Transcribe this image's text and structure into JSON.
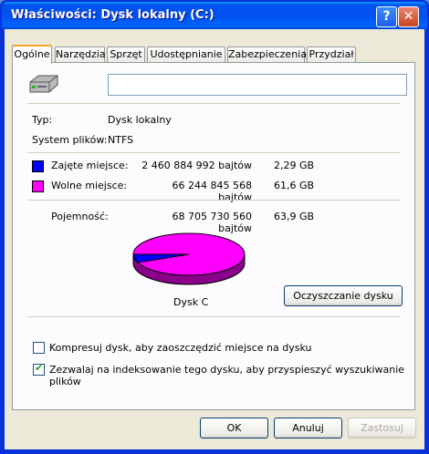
{
  "window": {
    "title": "Właściwości: Dysk lokalny (C:)",
    "help_glyph": "?",
    "close_glyph": "✕"
  },
  "tabs": [
    "Ogólne",
    "Narzędzia",
    "Sprzęt",
    "Udostępnianie",
    "Zabezpieczenia",
    "Przydział"
  ],
  "general": {
    "name_value": "",
    "type_label": "Typ:",
    "type_value": "Dysk lokalny",
    "fs_label": "System plików:",
    "fs_value": "NTFS",
    "used_label": "Zajęte miejsce:",
    "used_bytes": "2 460 884 992 bajtów",
    "used_gb": "2,29 GB",
    "free_label": "Wolne miejsce:",
    "free_bytes": "66 244 845 568 bajtów",
    "free_gb": "61,6 GB",
    "capacity_label": "Pojemność:",
    "capacity_bytes": "68 705 730 560 bajtów",
    "capacity_gb": "63,9 GB",
    "drive_label": "Dysk C",
    "cleanup_button": "Oczyszczanie dysku",
    "compress_label": "Kompresuj dysk, aby zaoszczędzić miejsce na dysku",
    "compress_checked": false,
    "index_label": "Zezwalaj na indeksowanie tego dysku, aby przyspieszyć wyszukiwanie plików",
    "index_checked": true
  },
  "colors": {
    "used": "#0000ff",
    "free": "#ff00ff"
  },
  "buttons": {
    "ok": "OK",
    "cancel": "Anuluj",
    "apply": "Zastosuj"
  }
}
